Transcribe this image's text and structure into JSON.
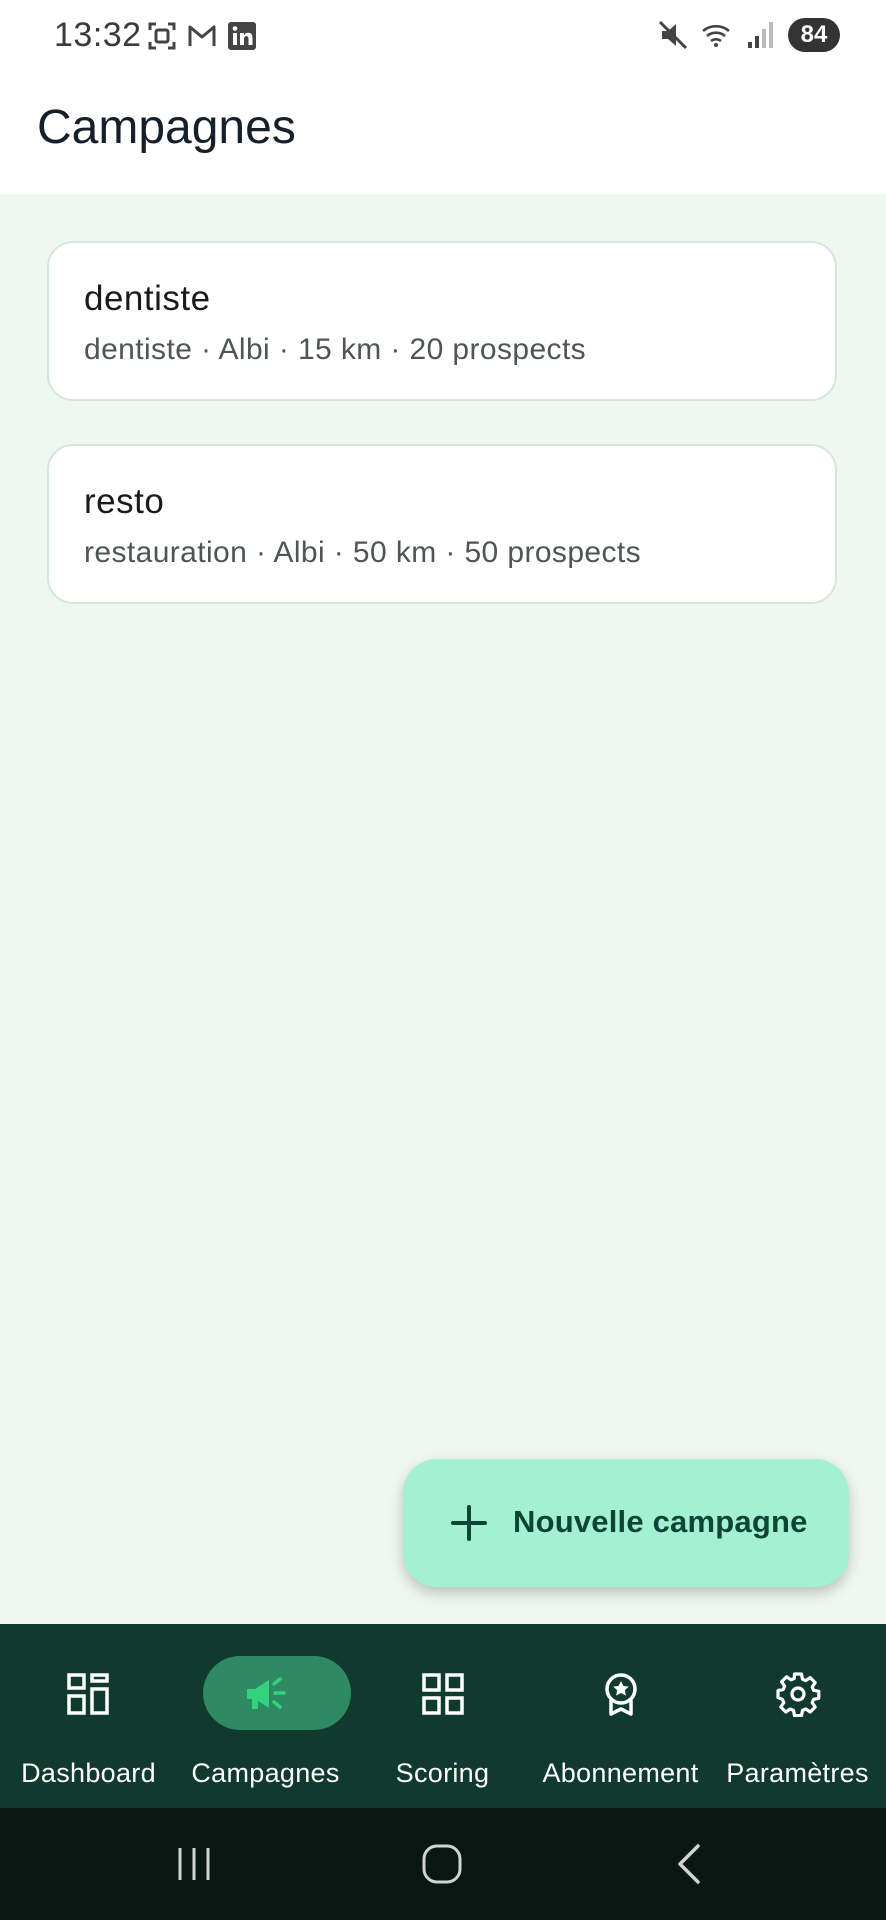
{
  "status_bar": {
    "time": "13:32",
    "battery": "84",
    "icons_left": [
      "screenshot-icon",
      "gmail-icon",
      "linkedin-icon"
    ],
    "icons_right": [
      "mute-icon",
      "wifi-icon",
      "signal-icon",
      "battery-icon"
    ]
  },
  "header": {
    "title": "Campagnes"
  },
  "campaigns": [
    {
      "title": "dentiste",
      "subtitle": "dentiste · Albi · 15 km · 20 prospects"
    },
    {
      "title": "resto",
      "subtitle": "restauration · Albi · 50 km · 50 prospects"
    }
  ],
  "fab": {
    "label": "Nouvelle campagne",
    "icon": "plus-icon"
  },
  "bottom_nav": {
    "items": [
      {
        "label": "Dashboard",
        "icon": "dashboard-icon",
        "active": false
      },
      {
        "label": "Campagnes",
        "icon": "megaphone-icon",
        "active": true
      },
      {
        "label": "Scoring",
        "icon": "grid-icon",
        "active": false
      },
      {
        "label": "Abonnement",
        "icon": "badge-icon",
        "active": false
      },
      {
        "label": "Paramètres",
        "icon": "gear-icon",
        "active": false
      }
    ]
  },
  "system_nav": [
    "recents-icon",
    "home-icon",
    "back-icon"
  ],
  "colors": {
    "background": "#eff7f2",
    "nav_background": "#103a2e",
    "nav_active_pill": "#2f8a63",
    "nav_active_icon": "#34d27e",
    "fab_background": "#a4f0d3",
    "fab_text": "#0d4536"
  }
}
